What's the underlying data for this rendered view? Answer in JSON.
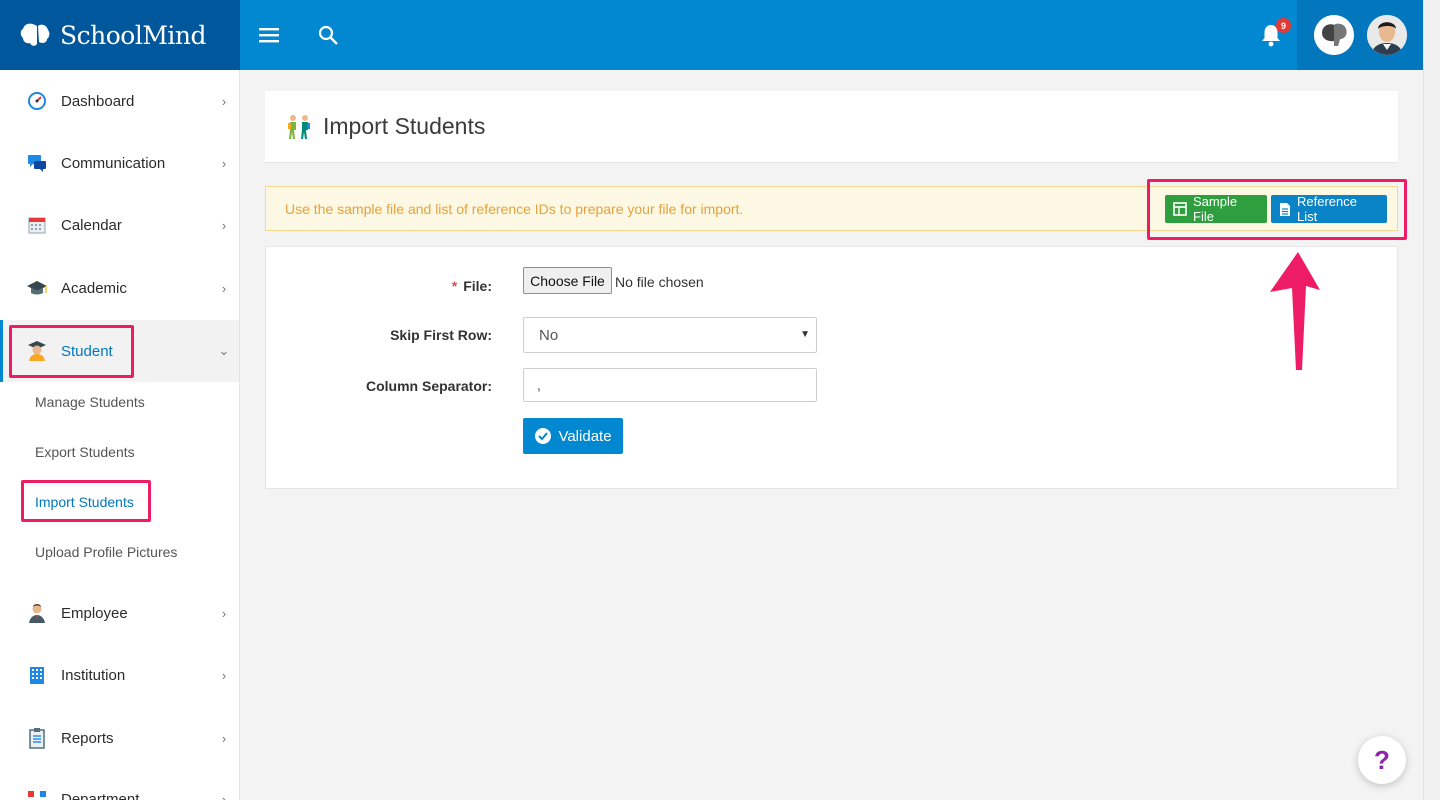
{
  "brand": {
    "name": "SchoolMind"
  },
  "header": {
    "notifications_count": "9",
    "icons": [
      "menu-icon",
      "search-icon",
      "bell-icon",
      "avatar",
      "avatar"
    ]
  },
  "sidebar": {
    "items": [
      {
        "label": "Dashboard",
        "icon": "dashboard-icon"
      },
      {
        "label": "Communication",
        "icon": "chat-icon"
      },
      {
        "label": "Calendar",
        "icon": "calendar-icon"
      },
      {
        "label": "Academic",
        "icon": "graduation-cap-icon"
      },
      {
        "label": "Student",
        "icon": "student-icon"
      },
      {
        "label": "Employee",
        "icon": "employee-icon"
      },
      {
        "label": "Institution",
        "icon": "building-icon"
      },
      {
        "label": "Reports",
        "icon": "clipboard-icon"
      },
      {
        "label": "Department",
        "icon": "department-icon"
      }
    ],
    "student_sub": [
      {
        "label": "Manage Students"
      },
      {
        "label": "Export Students"
      },
      {
        "label": "Import Students"
      },
      {
        "label": "Upload Profile Pictures"
      }
    ]
  },
  "page": {
    "title": "Import Students",
    "alert_text": "Use the sample file and list of reference IDs to prepare your file for import.",
    "sample_file_label": "Sample File",
    "reference_list_label": "Reference List"
  },
  "form": {
    "file_label": "File:",
    "file_required_mark": "*",
    "choose_file_label": "Choose File",
    "no_file_text": "No file chosen",
    "skip_first_row_label": "Skip First Row:",
    "skip_first_row_value": "No",
    "column_separator_label": "Column Separator:",
    "column_separator_value": ",",
    "validate_label": "Validate"
  },
  "help": {
    "label": "?"
  },
  "colors": {
    "primary": "#0288d1",
    "brand_dark": "#01579b",
    "success": "#2e9e3e",
    "highlight": "#ee1c64",
    "alert_text": "#e6a23c"
  }
}
